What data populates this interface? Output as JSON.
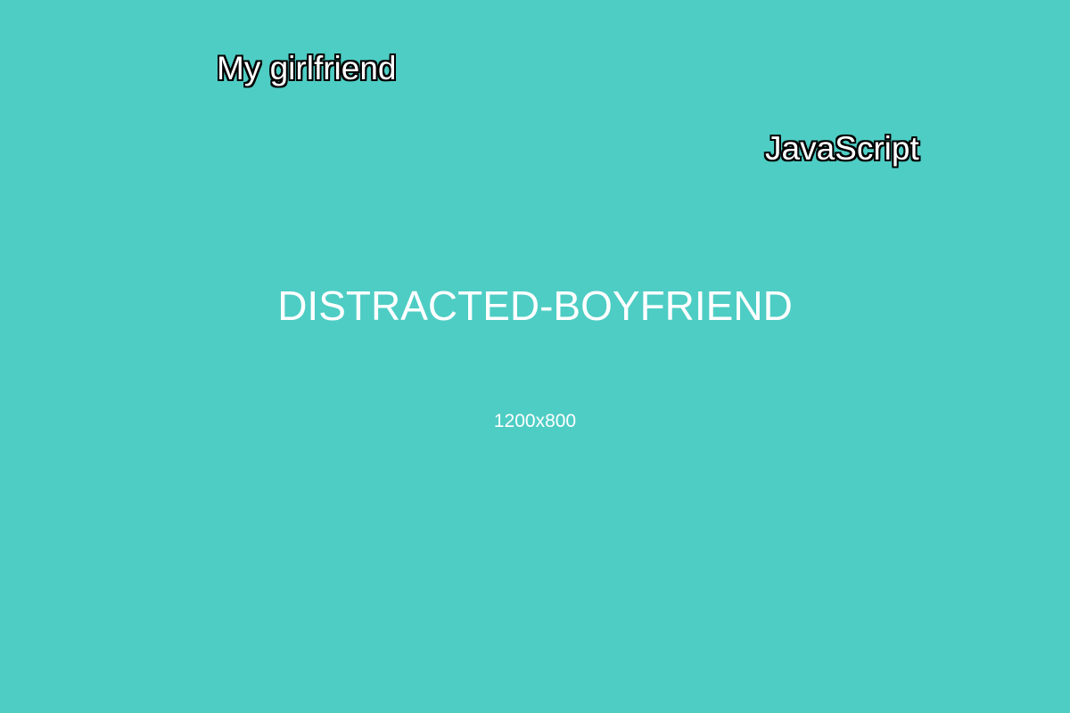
{
  "meme": {
    "template_name": "DISTRACTED-BOYFRIEND",
    "dimensions_label": "1200x800",
    "captions": {
      "girlfriend": "My girlfriend",
      "other": "JavaScript"
    }
  },
  "colors": {
    "background": "#4ecdc4",
    "text": "#ffffff",
    "outline": "#000000"
  }
}
